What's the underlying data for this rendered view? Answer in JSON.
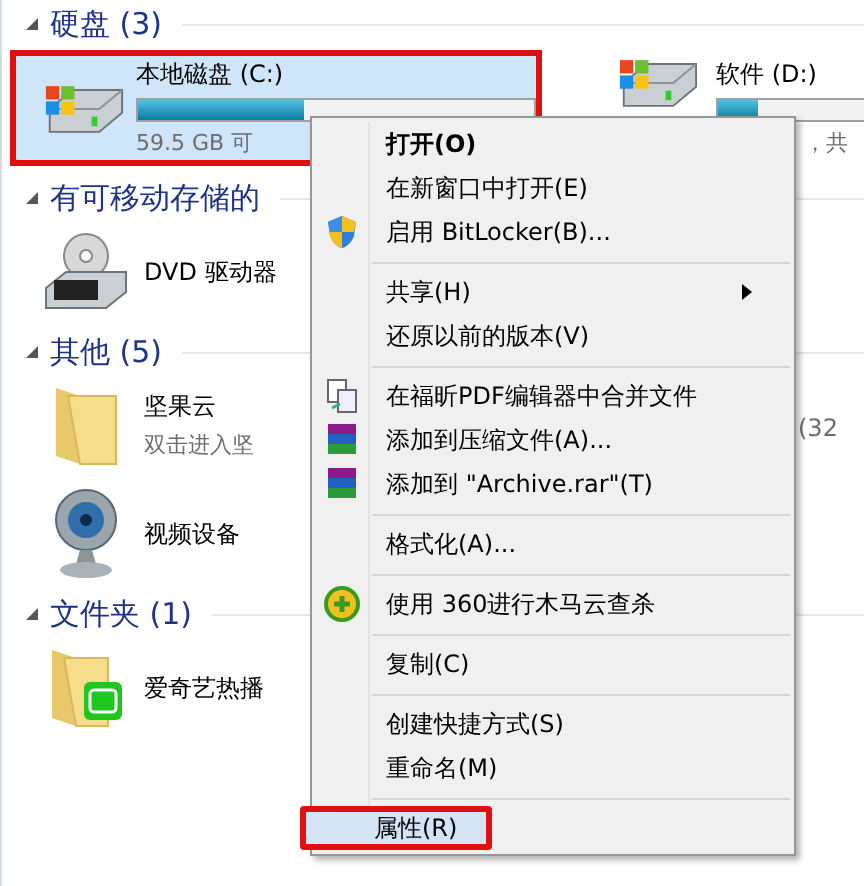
{
  "sections": [
    {
      "title": "硬盘 (3)",
      "expanded": true,
      "items": [
        {
          "kind": "drive",
          "name": "本地磁盘 (C:)",
          "level": 0.42,
          "info": "59.5 GB 可",
          "selected": true,
          "annotated": true
        },
        {
          "kind": "drive",
          "name": "软件 (D:)",
          "level": 0.1,
          "info": "，共",
          "selected": false
        }
      ]
    },
    {
      "title": "有可移动存储的",
      "expanded": true,
      "items": [
        {
          "kind": "dvd",
          "name": "DVD 驱动器",
          "selected": false
        }
      ]
    },
    {
      "title": "其他 (5)",
      "expanded": true,
      "items": [
        {
          "kind": "folder",
          "name": "坚果云",
          "info": "双击进入坚",
          "selected": false
        },
        {
          "kind": "partial",
          "info": "(32"
        },
        {
          "kind": "webcam",
          "name": "视频设备",
          "selected": false
        }
      ]
    },
    {
      "title": "文件夹 (1)",
      "expanded": true,
      "items": [
        {
          "kind": "app-folder",
          "name": "爱奇艺热播",
          "selected": false
        }
      ]
    }
  ],
  "context_menu": [
    {
      "kind": "item",
      "label": "打开(O)",
      "default": true,
      "selected": false,
      "submenu": false,
      "annotated": false
    },
    {
      "kind": "item",
      "label": "在新窗口中打开(E)",
      "default": false,
      "selected": false,
      "submenu": false,
      "annotated": false
    },
    {
      "kind": "item",
      "label": "启用 BitLocker(B)...",
      "default": false,
      "selected": false,
      "submenu": false,
      "annotated": false
    },
    {
      "kind": "separator"
    },
    {
      "kind": "item",
      "label": "共享(H)",
      "default": false,
      "selected": false,
      "submenu": true,
      "annotated": false
    },
    {
      "kind": "item",
      "label": "还原以前的版本(V)",
      "default": false,
      "selected": false,
      "submenu": false,
      "annotated": false
    },
    {
      "kind": "separator"
    },
    {
      "kind": "item",
      "label": "在福昕PDF编辑器中合并文件",
      "default": false,
      "selected": false,
      "submenu": false,
      "annotated": false
    },
    {
      "kind": "item",
      "label": "添加到压缩文件(A)...",
      "default": false,
      "selected": false,
      "submenu": false,
      "annotated": false
    },
    {
      "kind": "item",
      "label": "添加到 \"Archive.rar\"(T)",
      "default": false,
      "selected": false,
      "submenu": false,
      "annotated": false
    },
    {
      "kind": "separator"
    },
    {
      "kind": "item",
      "label": "格式化(A)...",
      "default": false,
      "selected": false,
      "submenu": false,
      "annotated": false
    },
    {
      "kind": "separator"
    },
    {
      "kind": "item",
      "label": "使用 360进行木马云查杀",
      "default": false,
      "selected": false,
      "submenu": false,
      "annotated": false
    },
    {
      "kind": "separator"
    },
    {
      "kind": "item",
      "label": "复制(C)",
      "default": false,
      "selected": false,
      "submenu": false,
      "annotated": false
    },
    {
      "kind": "separator"
    },
    {
      "kind": "item",
      "label": "创建快捷方式(S)",
      "default": false,
      "selected": false,
      "submenu": false,
      "annotated": false
    },
    {
      "kind": "item",
      "label": "重命名(M)",
      "default": false,
      "selected": false,
      "submenu": false,
      "annotated": false
    },
    {
      "kind": "separator"
    },
    {
      "kind": "item",
      "label": "属性(R)",
      "default": false,
      "selected": true,
      "submenu": false,
      "annotated": true
    }
  ]
}
